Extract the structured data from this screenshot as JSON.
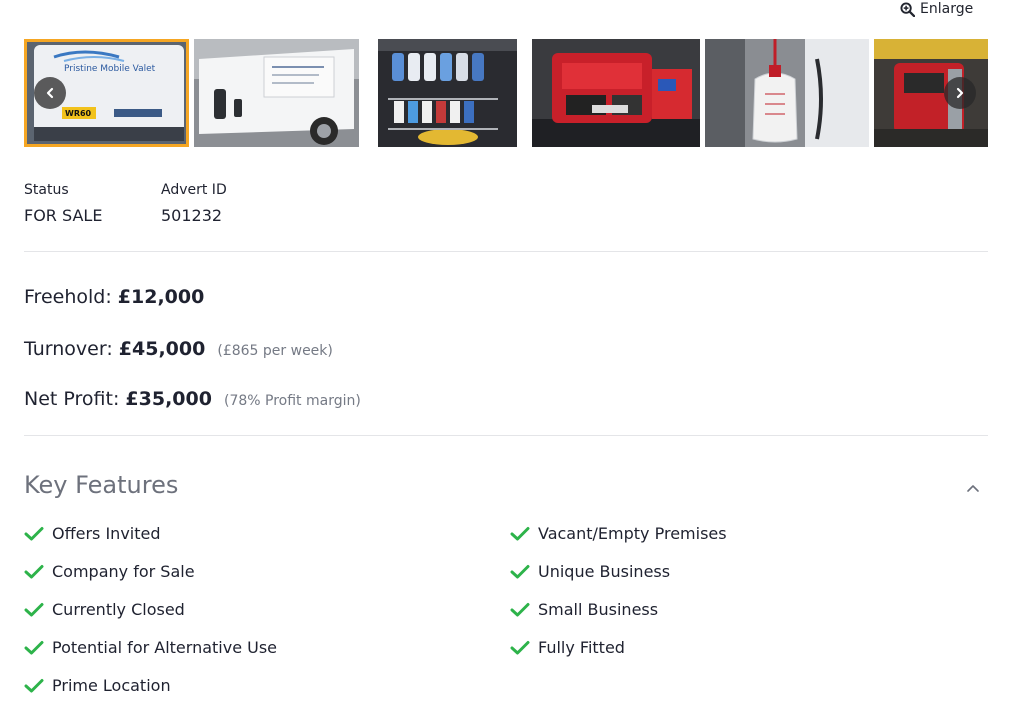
{
  "enlarge_label": "Enlarge",
  "gallery": {
    "thumbnails": [
      {
        "subject": "van-rear-signage",
        "active": true
      },
      {
        "subject": "white-van-side"
      },
      {
        "subject": "cleaning-products-rack"
      },
      {
        "subject": "red-generator"
      },
      {
        "subject": "pressure-sprayer-tank"
      },
      {
        "subject": "equipment-in-van"
      }
    ],
    "van_sign_text": "Pristine Mobile Valet",
    "plate_text": "WR60"
  },
  "meta": {
    "status_label": "Status",
    "status_value": "FOR SALE",
    "advert_label": "Advert ID",
    "advert_value": "501232"
  },
  "pricing": {
    "freehold_label": "Freehold:",
    "freehold_value": "£12,000",
    "turnover_label": "Turnover:",
    "turnover_value": "£45,000",
    "turnover_note": "(£865 per week)",
    "profit_label": "Net Profit:",
    "profit_value": "£35,000",
    "profit_note": "(78% Profit margin)"
  },
  "key_features": {
    "title": "Key Features",
    "left": [
      "Offers Invited",
      "Company for Sale",
      "Currently Closed",
      "Potential for Alternative Use",
      "Prime Location"
    ],
    "right": [
      "Vacant/Empty Premises",
      "Unique Business",
      "Small Business",
      "Fully Fitted"
    ]
  },
  "colors": {
    "accent": "#f5a623",
    "check": "#2db34a",
    "muted": "#757a85"
  },
  "icons": [
    "zoom-in-icon",
    "chevron-left-icon",
    "chevron-right-icon",
    "chevron-up-icon",
    "check-icon"
  ]
}
